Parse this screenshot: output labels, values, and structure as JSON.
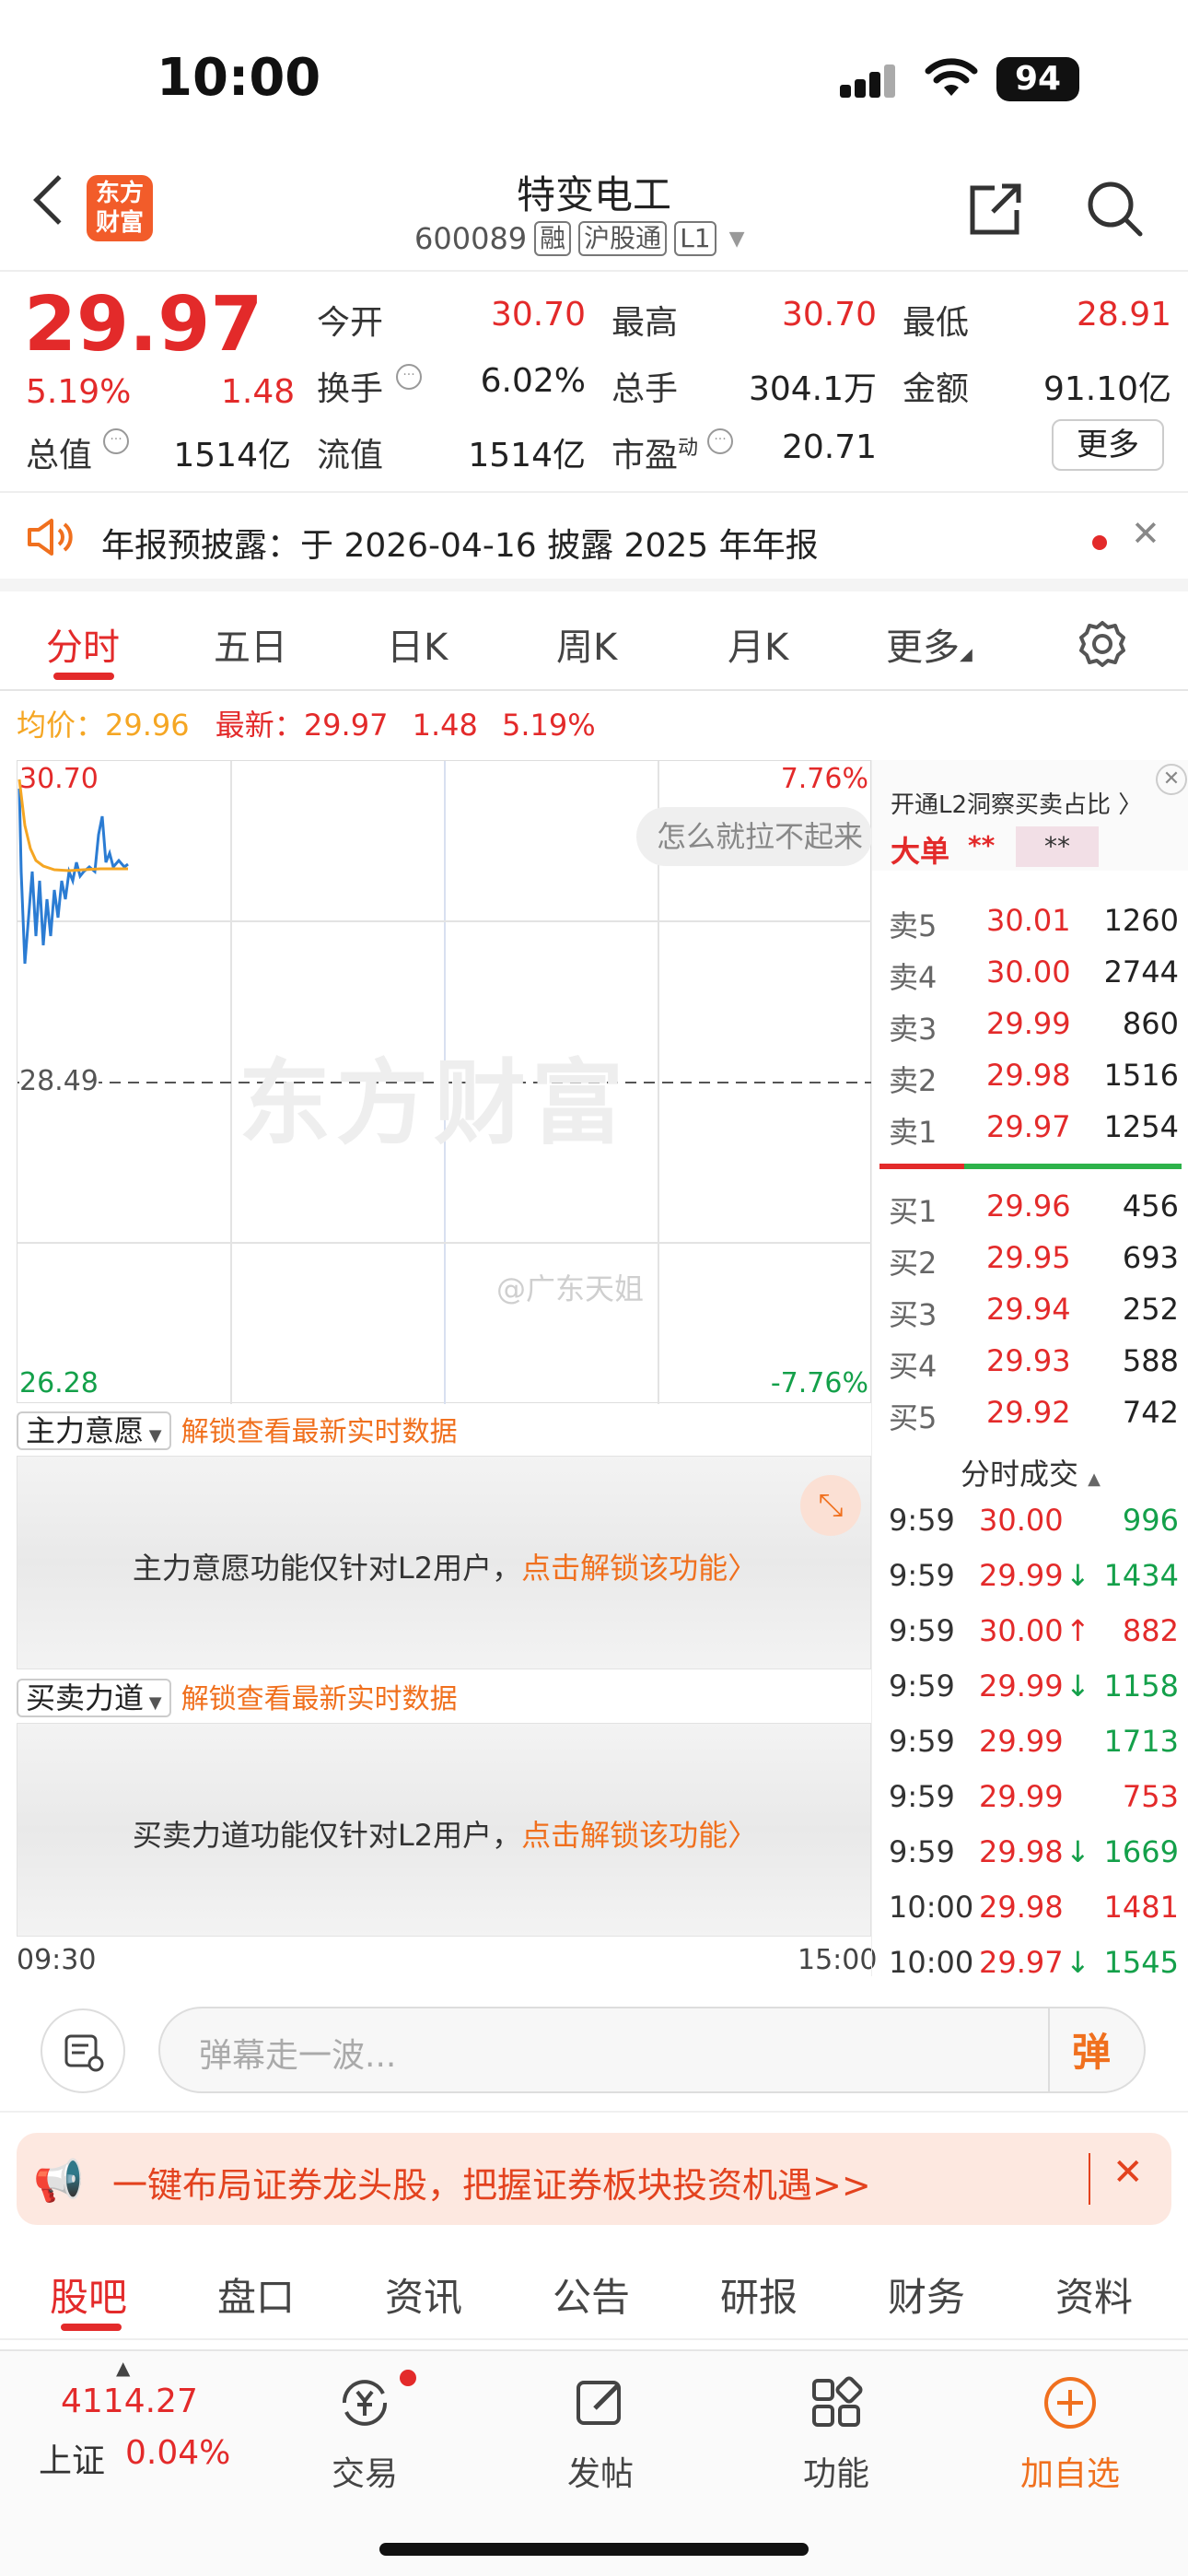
{
  "status_bar": {
    "time": "10:00",
    "battery": "94"
  },
  "header": {
    "logo": "东方财富",
    "title": "特变电工",
    "code": "600089",
    "tags": [
      "融",
      "沪股通",
      "L1"
    ]
  },
  "quote": {
    "price": "29.97",
    "change_pct": "5.19%",
    "change": "1.48",
    "open_label": "今开",
    "open": "30.70",
    "high_label": "最高",
    "high": "30.70",
    "low_label": "最低",
    "low": "28.91",
    "turnover_label": "换手",
    "turnover": "6.02%",
    "volume_label": "总手",
    "volume": "304.1万",
    "amount_label": "金额",
    "amount": "91.10亿",
    "mcap_label": "总值",
    "mcap": "1514亿",
    "float_label": "流值",
    "float": "1514亿",
    "pe_label": "市盈",
    "pe_sup": "动",
    "pe": "20.71",
    "more": "更多"
  },
  "notice": {
    "text": "年报预披露：于 2026-04-16 披露 2025 年年报"
  },
  "tabs": [
    "分时",
    "五日",
    "日K",
    "周K",
    "月K",
    "更多"
  ],
  "intraday": {
    "avg_label": "均价：",
    "avg": "29.96",
    "latest_label": "最新：",
    "latest": "29.97",
    "latest_chg": "1.48",
    "latest_pct": "5.19%",
    "y_top": "30.70",
    "y_mid": "28.49",
    "y_bottom": "26.28",
    "pct_top": "7.76%",
    "pct_bottom": "-7.76%",
    "bubble": "怎么就拉不起来",
    "watermark": "东方财富",
    "weibo": "@广东天姐",
    "time_start": "09:30",
    "time_end": "15:00"
  },
  "l2": {
    "title": "开通L2洞察买卖占比",
    "big_order_label": "大单",
    "big_a": "**",
    "big_b": "**"
  },
  "order_book": {
    "asks": [
      {
        "label": "卖5",
        "price": "30.01",
        "vol": "1260"
      },
      {
        "label": "卖4",
        "price": "30.00",
        "vol": "2744"
      },
      {
        "label": "卖3",
        "price": "29.99",
        "vol": "860"
      },
      {
        "label": "卖2",
        "price": "29.98",
        "vol": "1516"
      },
      {
        "label": "卖1",
        "price": "29.97",
        "vol": "1254"
      }
    ],
    "bids": [
      {
        "label": "买1",
        "price": "29.96",
        "vol": "456"
      },
      {
        "label": "买2",
        "price": "29.95",
        "vol": "693"
      },
      {
        "label": "买3",
        "price": "29.94",
        "vol": "252"
      },
      {
        "label": "买4",
        "price": "29.93",
        "vol": "588"
      },
      {
        "label": "买5",
        "price": "29.92",
        "vol": "742"
      }
    ]
  },
  "trades": {
    "title": "分时成交",
    "rows": [
      {
        "t": "9:59",
        "p": "30.00",
        "a": "",
        "v": "996",
        "c": "green"
      },
      {
        "t": "9:59",
        "p": "29.99",
        "a": "↓",
        "v": "1434",
        "c": "green"
      },
      {
        "t": "9:59",
        "p": "30.00",
        "a": "↑",
        "v": "882",
        "c": "red"
      },
      {
        "t": "9:59",
        "p": "29.99",
        "a": "↓",
        "v": "1158",
        "c": "green"
      },
      {
        "t": "9:59",
        "p": "29.99",
        "a": "",
        "v": "1713",
        "c": "green"
      },
      {
        "t": "9:59",
        "p": "29.99",
        "a": "",
        "v": "753",
        "c": "red"
      },
      {
        "t": "9:59",
        "p": "29.98",
        "a": "↓",
        "v": "1669",
        "c": "green"
      },
      {
        "t": "10:00",
        "p": "29.98",
        "a": "",
        "v": "1481",
        "c": "red"
      },
      {
        "t": "10:00",
        "p": "29.97",
        "a": "↓",
        "v": "1545",
        "c": "green"
      }
    ]
  },
  "panels": {
    "p1_title": "主力意愿",
    "p1_unlock": "解锁查看最新实时数据",
    "p1_text": "主力意愿功能仅针对L2用户，",
    "p1_link": "点击解锁该功能",
    "p2_title": "买卖力道",
    "p2_unlock": "解锁查看最新实时数据",
    "p2_text": "买卖力道功能仅针对L2用户，",
    "p2_link": "点击解锁该功能"
  },
  "comment": {
    "placeholder": "弹幕走一波...",
    "danmu_btn": "弹"
  },
  "banner": {
    "text": "一键布局证券龙头股，把握证券板块投资机遇>>"
  },
  "bottom_tabs": [
    "股吧",
    "盘口",
    "资讯",
    "公告",
    "研报",
    "财务",
    "资料"
  ],
  "dock": {
    "index_value": "4114.27",
    "index_name": "上证",
    "index_pct": "0.04%",
    "trade": "交易",
    "post": "发帖",
    "func": "功能",
    "add": "加自选"
  },
  "colors": {
    "up": "#e32a2a",
    "down": "#14a04a",
    "accent": "#f0701e",
    "avg_line": "#f5a623",
    "price_line": "#2b7cd3"
  }
}
